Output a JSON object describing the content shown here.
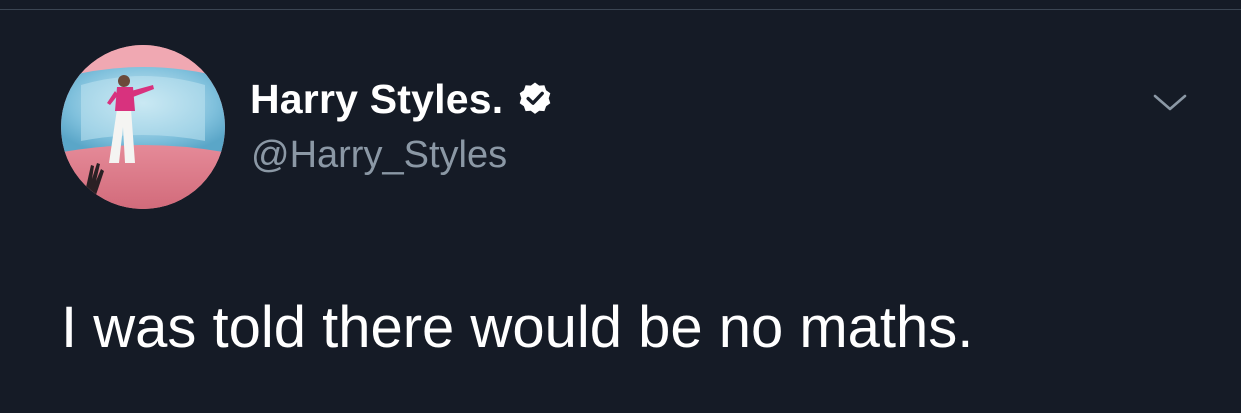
{
  "tweet": {
    "author": {
      "display_name": "Harry Styles.",
      "handle": "@Harry_Styles",
      "verified": true
    },
    "text": "I was told there would be no maths.",
    "icons": {
      "verified": "verified-badge-icon",
      "menu": "chevron-down-icon"
    }
  },
  "colors": {
    "background": "#151b26",
    "text_primary": "#ffffff",
    "text_secondary": "#8b98a5",
    "divider": "#3b4552"
  }
}
